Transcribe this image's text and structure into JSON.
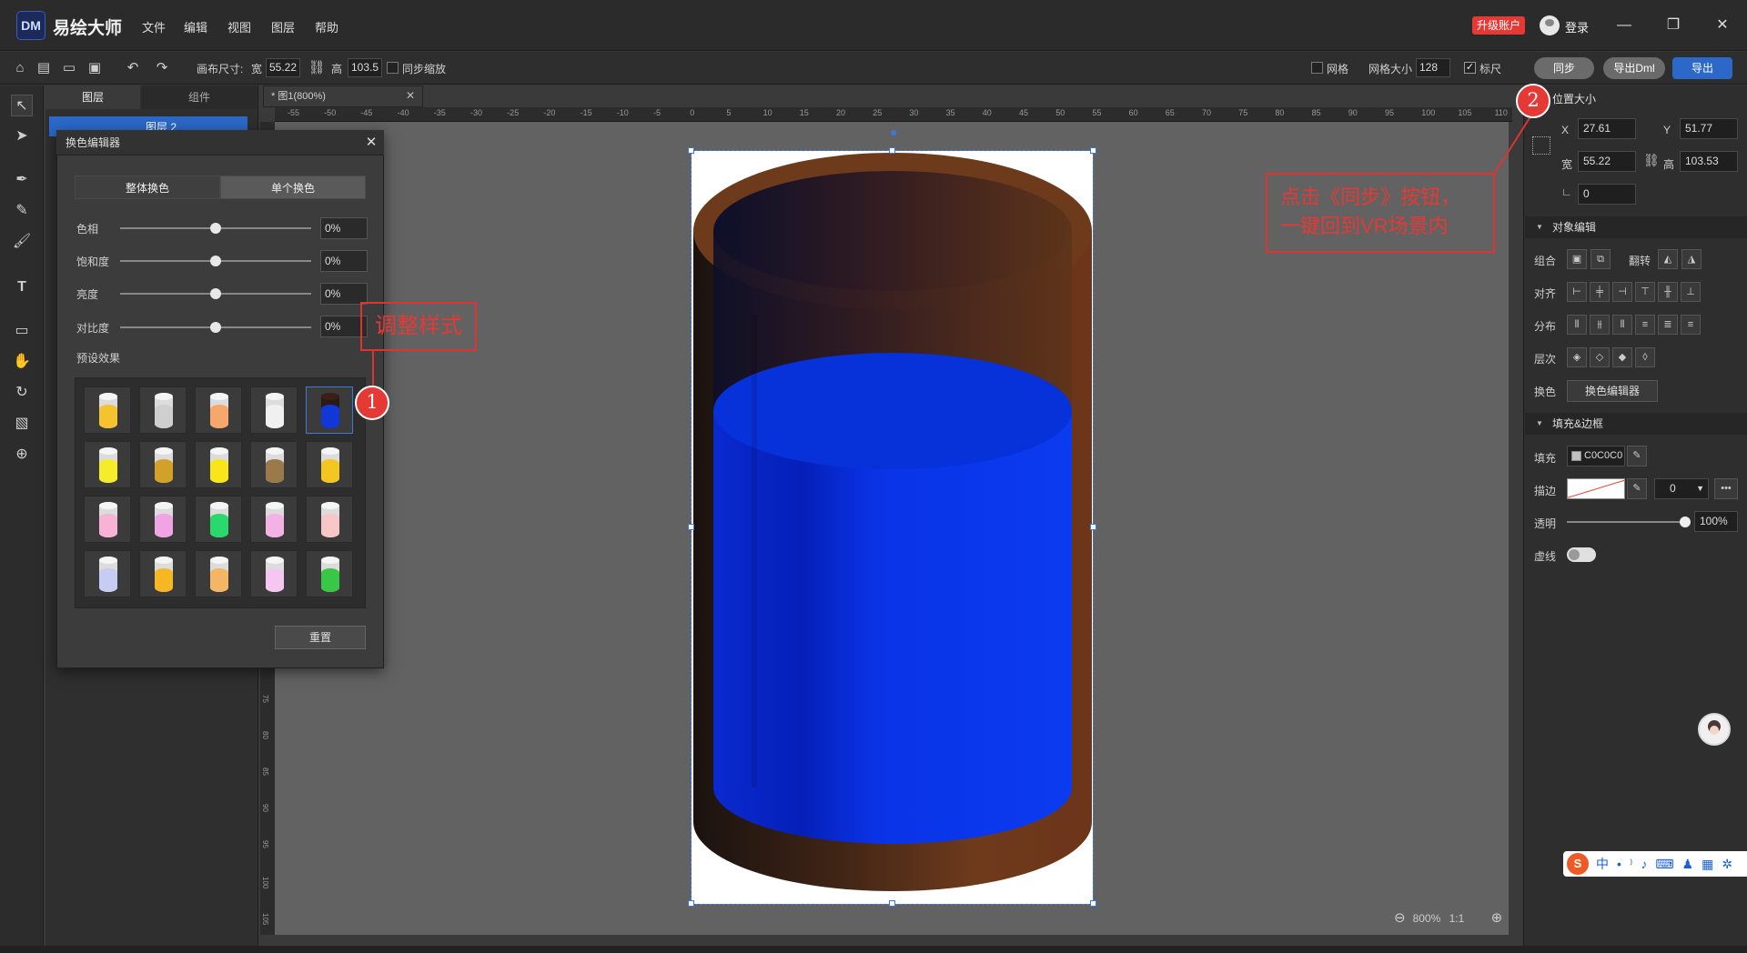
{
  "app": {
    "logo_text": "DM",
    "name": "易绘大师",
    "menus": [
      "文件",
      "编辑",
      "视图",
      "图层",
      "帮助"
    ],
    "upgrade": "升级账户",
    "login": "登录"
  },
  "toolbar": {
    "canvas_size_label": "画布尺寸:",
    "width_label": "宽",
    "width_value": "55.22",
    "height_label": "高",
    "height_value": "103.5",
    "sync_scale_label": "同步缩放",
    "grid_label": "网格",
    "grid_size_label": "网格大小",
    "grid_size_value": "128",
    "ruler_label": "标尺",
    "sync_btn": "同步",
    "export_dml_btn": "导出Dml",
    "export_btn": "导出"
  },
  "panels": {
    "layers_tab": "图层",
    "components_tab": "组件",
    "layer_name": "图层 2"
  },
  "doc_tab": {
    "title": "* 图1(800%)"
  },
  "ruler_ticks": [
    "-55",
    "-50",
    "-45",
    "-40",
    "-35",
    "-30",
    "-25",
    "-20",
    "-15",
    "-10",
    "-5",
    "0",
    "5",
    "10",
    "15",
    "20",
    "25",
    "30",
    "35",
    "40",
    "45",
    "50",
    "55",
    "60",
    "65",
    "70",
    "75",
    "80",
    "85",
    "90",
    "95",
    "100",
    "105",
    "110"
  ],
  "vruler_ticks": [
    "75",
    "80",
    "85",
    "90",
    "95",
    "100",
    "105"
  ],
  "color_editor": {
    "title": "换色编辑器",
    "tab_all": "整体换色",
    "tab_single": "单个换色",
    "hue_label": "色相",
    "hue_value": "0%",
    "sat_label": "饱和度",
    "sat_value": "0%",
    "bright_label": "亮度",
    "bright_value": "0%",
    "contrast_label": "对比度",
    "contrast_value": "0%",
    "preset_label": "预设效果",
    "reset": "重置",
    "presets": [
      [
        "#f5c230",
        "#cfcfcf",
        "#f6a86c",
        "#f0f0f0",
        "#1237d8"
      ],
      [
        "#f7ec2a",
        "#d1a12a",
        "#f8e51a",
        "#9a7a4a",
        "#f5c520"
      ],
      [
        "#f7b2d6",
        "#f0a4e4",
        "#29d96b",
        "#f3b2e4",
        "#f7c6c6"
      ],
      [
        "#c7ccf4",
        "#f5b724",
        "#f4b664",
        "#f4c6f0",
        "#39c845"
      ]
    ]
  },
  "right": {
    "pos_size_title": "位置大小",
    "x_label": "X",
    "x_value": "27.61",
    "y_label": "Y",
    "y_value": "51.77",
    "w_label": "宽",
    "w_value": "55.22",
    "h_label": "高",
    "h_value": "103.53",
    "angle_value": "0",
    "obj_edit_title": "对象编辑",
    "group_label": "组合",
    "flip_label": "翻转",
    "align_label": "对齐",
    "dist_label": "分布",
    "layer_label": "层次",
    "recolor_label": "换色",
    "recolor_btn": "换色编辑器",
    "fill_title": "填充&边框",
    "fill_label": "填充",
    "fill_value": "C0C0C0",
    "stroke_label": "描边",
    "stroke_width": "0",
    "opacity_label": "透明",
    "opacity_value": "100%",
    "dash_label": "虚线"
  },
  "annotations": {
    "callout1": "调整样式",
    "badge1": "1",
    "callout2_line1": "点击《同步》按钮，",
    "callout2_line2": "一键回到VR场景内",
    "badge2": "2"
  },
  "status": {
    "zoom": "800%",
    "ratio": "1:1"
  },
  "colors": {
    "accent": "#2b68c7",
    "annotation": "#e53935",
    "cup_brown": "#6e3a1c",
    "liquid_blue": "#0a33e6"
  }
}
